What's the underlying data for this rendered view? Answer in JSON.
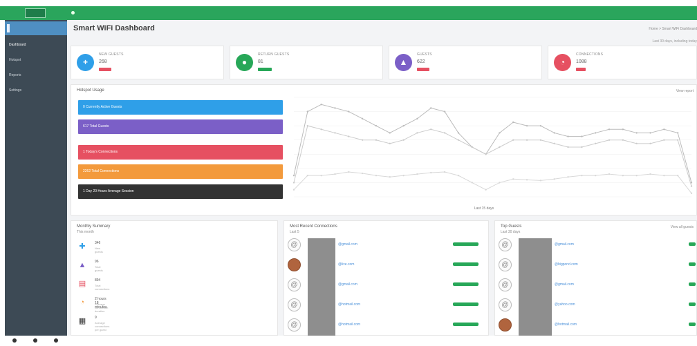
{
  "header": {
    "logo_text": "",
    "title": "Smart WiFi Dashboard",
    "breadcrumb": "Home > Smart WiFi Dashboard",
    "period_note": "Last 30 days, including today"
  },
  "sidebar": {
    "brand": "",
    "items": [
      {
        "label": "Dashboard",
        "active": true
      },
      {
        "label": "Hotspot"
      },
      {
        "label": "Reports"
      },
      {
        "label": "Settings"
      }
    ]
  },
  "stats": [
    {
      "label": "NEW GUESTS",
      "value": "268",
      "color": "#2f9fe8",
      "icon": "plus-icon",
      "pill": "#e65061"
    },
    {
      "label": "RETURN GUESTS",
      "value": "81",
      "color": "#27a758",
      "icon": "user-icon",
      "pill": "#27a758"
    },
    {
      "label": "GUESTS",
      "value": "622",
      "color": "#7b5fc7",
      "icon": "shirt-icon",
      "pill": "#e65061"
    },
    {
      "label": "CONNECTIONS",
      "value": "1088",
      "color": "#e65061",
      "icon": "pie-icon",
      "pill": "#e65061"
    }
  ],
  "hotspot": {
    "title": "Hotspot Usage",
    "chart_link": "View report",
    "bars": [
      {
        "text": "0 Currently Active Guests",
        "color": "#2f9fe8"
      },
      {
        "text": "617 Total Guests",
        "color": "#7b5fc7"
      },
      {
        "text": "1 Today's Connections",
        "color": "#e65061"
      },
      {
        "text": "2262 Total Connections",
        "color": "#f39a3c"
      },
      {
        "text": "1 Day 20 Hours Average Session",
        "color": "#333333"
      }
    ],
    "xlabel": "Last 15 days"
  },
  "chart_data": {
    "type": "line",
    "x": [
      "1",
      "2",
      "3",
      "4",
      "5",
      "6",
      "7",
      "8",
      "9",
      "10",
      "11",
      "12",
      "13",
      "14",
      "15",
      "16",
      "17",
      "18",
      "19",
      "20",
      "21",
      "22",
      "23",
      "24",
      "25",
      "26",
      "27",
      "28",
      "29",
      "30"
    ],
    "xlabel": "Last 15 days",
    "ylabel": "",
    "series": [
      {
        "values": [
          3,
          12,
          13,
          12.5,
          12,
          11,
          10,
          9,
          10,
          11,
          12.5,
          12,
          9,
          7,
          6,
          9,
          10.5,
          10,
          10,
          9,
          8.5,
          8.5,
          9,
          9.5,
          9.5,
          9,
          9,
          9.5,
          9,
          2
        ]
      },
      {
        "values": [
          2,
          10,
          9.5,
          9,
          8.5,
          8,
          8,
          7.5,
          8,
          9,
          9.5,
          9,
          8,
          7,
          6,
          7,
          8,
          8,
          8,
          7.5,
          7,
          7,
          7.5,
          8,
          8,
          7.5,
          7.5,
          8,
          8,
          1.5
        ]
      },
      {
        "values": [
          1,
          3,
          3,
          3.2,
          3.5,
          3.3,
          3,
          2.8,
          3,
          3.2,
          3.4,
          3.5,
          3,
          2,
          1,
          2,
          2.5,
          2.4,
          2.3,
          2.5,
          2.8,
          3,
          3,
          3.2,
          3,
          3,
          3.2,
          3,
          3,
          0.5
        ]
      }
    ],
    "ylim": [
      0,
      14
    ],
    "colors": [
      "#bbbbbb",
      "#cccccc",
      "#d8d8d8"
    ]
  },
  "monthly": {
    "title": "Monthly Summary",
    "subtitle": "This month",
    "items": [
      {
        "value": "346",
        "desc": "New guests",
        "icon": "plus-icon",
        "color": "#2f9fe8"
      },
      {
        "value": "96",
        "desc": "Total guests",
        "icon": "user-icon",
        "color": "#7b5fc7"
      },
      {
        "value": "894",
        "desc": "Total connections",
        "icon": "chart-icon",
        "color": "#e65061"
      },
      {
        "value": "2 hours 18 minutes",
        "desc": "Average connection duration",
        "icon": "pie-icon",
        "color": "#f39a3c"
      },
      {
        "value": "9",
        "desc": "Average connections per guest",
        "icon": "calendar-icon",
        "color": "#333333"
      }
    ]
  },
  "recent": {
    "title": "Most Recent Connections",
    "subtitle": "Last 5",
    "rows": [
      {
        "email": "@gmail.com",
        "photo": false
      },
      {
        "email": "@live.com",
        "photo": true
      },
      {
        "email": "@gmail.com",
        "photo": false
      },
      {
        "email": "@hotmail.com",
        "photo": false
      },
      {
        "email": "@hotmail.com",
        "photo": false
      }
    ]
  },
  "top": {
    "title": "Top Guests",
    "subtitle": "Last 30 days",
    "link": "View all guests",
    "rows": [
      {
        "email": "@gmail.com",
        "photo": false
      },
      {
        "email": "@bigpond.com",
        "photo": false
      },
      {
        "email": "@gmail.com",
        "photo": false
      },
      {
        "email": "@yahoo.com",
        "photo": false
      },
      {
        "email": "@hotmail.com",
        "photo": true
      }
    ]
  }
}
